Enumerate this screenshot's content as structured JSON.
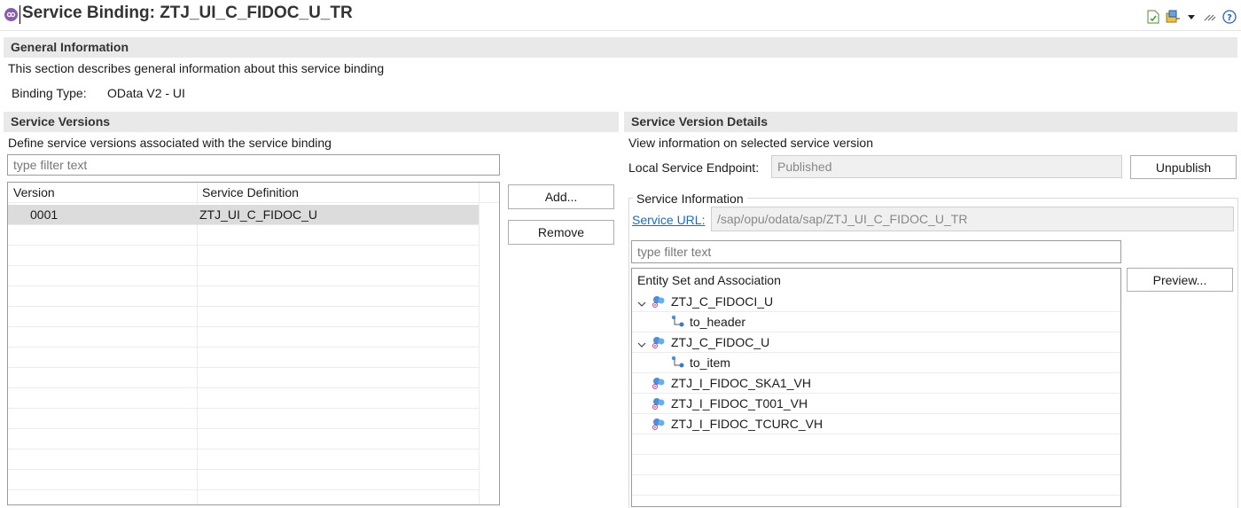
{
  "header": {
    "title": "Service Binding: ZTJ_UI_C_FIDOC_U_TR",
    "toolbar_icons": [
      "publish-icon",
      "related-objects-icon",
      "dropdown-arrow-icon",
      "minimize-icon",
      "help-icon"
    ]
  },
  "general": {
    "heading": "General Information",
    "description": "This section describes general information about this service binding",
    "binding_type_label": "Binding Type:",
    "binding_type_value": "OData V2 - UI"
  },
  "versions": {
    "heading": "Service Versions",
    "description": "Define service versions associated with the service binding",
    "filter_placeholder": "type filter text",
    "columns": [
      "Version",
      "Service Definition"
    ],
    "rows": [
      {
        "version": "0001",
        "definition": "ZTJ_UI_C_FIDOC_U"
      }
    ],
    "add_label": "Add...",
    "remove_label": "Remove"
  },
  "details": {
    "heading": "Service Version Details",
    "description": "View information on selected service version",
    "endpoint_label": "Local Service Endpoint:",
    "endpoint_value": "Published",
    "unpublish_label": "Unpublish",
    "service_info_legend": "Service Information",
    "service_url_label": "Service URL:",
    "service_url_value": "/sap/opu/odata/sap/ZTJ_UI_C_FIDOC_U_TR",
    "filter_placeholder": "type filter text",
    "tree_header": "Entity Set and Association",
    "preview_label": "Preview...",
    "tree": [
      {
        "label": "ZTJ_C_FIDOCI_U",
        "type": "entity",
        "expanded": true,
        "level": 0
      },
      {
        "label": "to_header",
        "type": "association",
        "level": 1
      },
      {
        "label": "ZTJ_C_FIDOC_U",
        "type": "entity",
        "expanded": true,
        "level": 0
      },
      {
        "label": "to_item",
        "type": "association",
        "level": 1
      },
      {
        "label": "ZTJ_I_FIDOC_SKA1_VH",
        "type": "entity",
        "level": 0
      },
      {
        "label": "ZTJ_I_FIDOC_T001_VH",
        "type": "entity",
        "level": 0
      },
      {
        "label": "ZTJ_I_FIDOC_TCURC_VH",
        "type": "entity",
        "level": 0
      }
    ]
  }
}
